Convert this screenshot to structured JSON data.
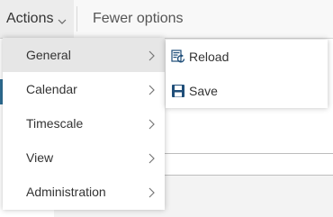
{
  "toolbar": {
    "actions_label": "Actions",
    "fewer_options_label": "Fewer options"
  },
  "menu": {
    "items": [
      {
        "label": "General"
      },
      {
        "label": "Calendar"
      },
      {
        "label": "Timescale"
      },
      {
        "label": "View"
      },
      {
        "label": "Administration"
      }
    ],
    "active_index": 0
  },
  "submenu": {
    "items": [
      {
        "label": "Reload",
        "icon": "reload-icon"
      },
      {
        "label": "Save",
        "icon": "save-icon"
      }
    ]
  },
  "colors": {
    "icon_blue": "#1f4e79",
    "background_accent": "#2f6f95"
  }
}
